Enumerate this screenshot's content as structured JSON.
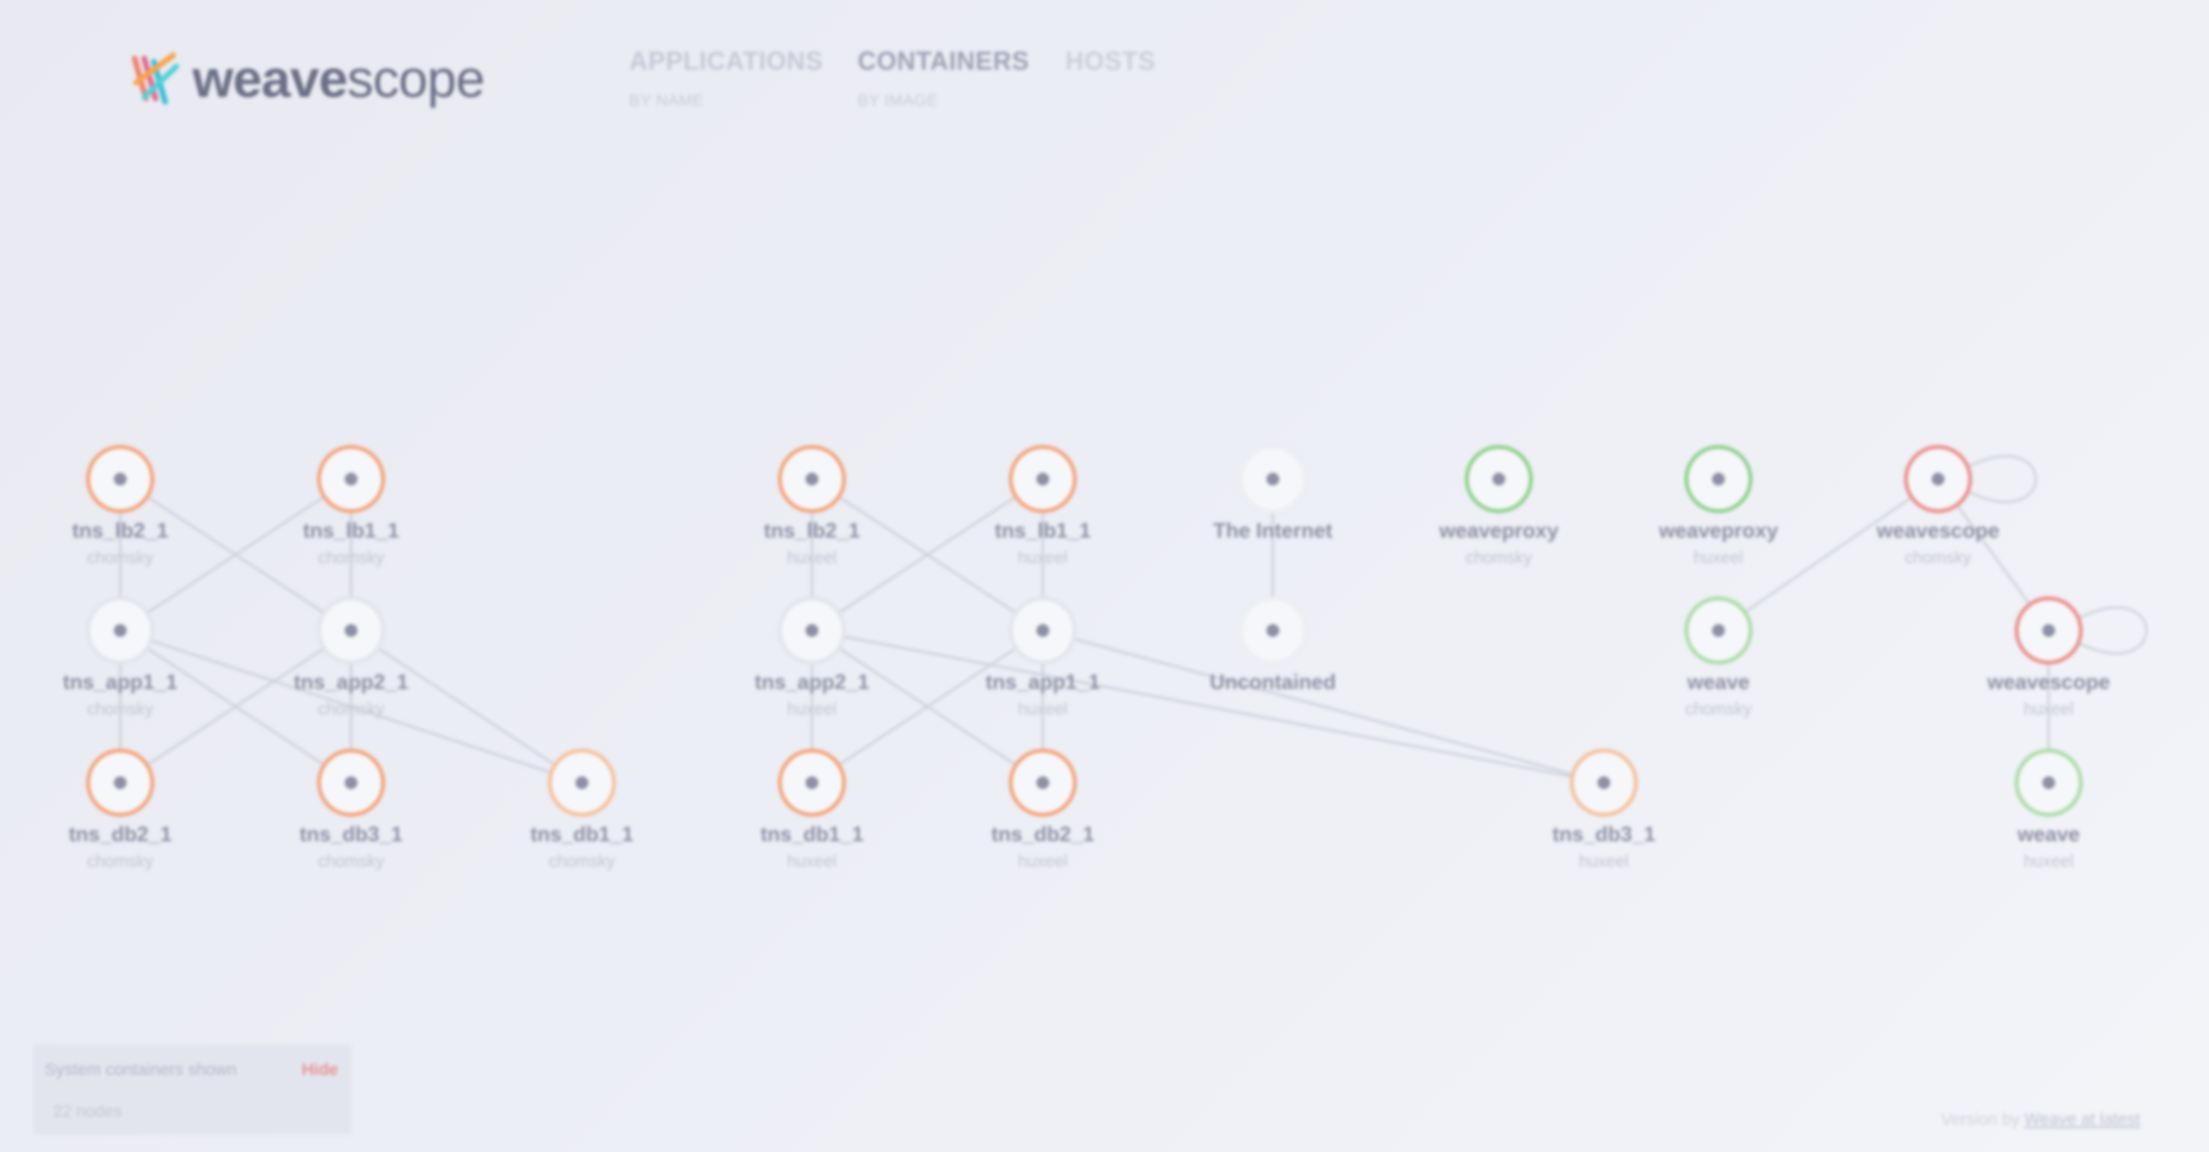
{
  "app": {
    "logo_weave": "weave",
    "logo_scope": "scope"
  },
  "topologies": [
    {
      "label": "APPLICATIONS",
      "sub": "BY NAME"
    },
    {
      "label": "CONTAINERS",
      "sub": "BY IMAGE"
    },
    {
      "label": "HOSTS",
      "sub": ""
    }
  ],
  "nodes": [
    {
      "id": "n1",
      "label": "tns_lb2_1",
      "sub": "chomsky",
      "color": "#f3a37a"
    },
    {
      "id": "n2",
      "label": "tns_lb1_1",
      "sub": "chomsky",
      "color": "#f3a37a"
    },
    {
      "id": "n3",
      "label": "tns_app1_1",
      "sub": "chomsky",
      "color": "#e2e4ec"
    },
    {
      "id": "n4",
      "label": "tns_app2_1",
      "sub": "chomsky",
      "color": "#e2e4ec"
    },
    {
      "id": "n5",
      "label": "tns_db2_1",
      "sub": "chomsky",
      "color": "#f3a37a"
    },
    {
      "id": "n6",
      "label": "tns_db3_1",
      "sub": "chomsky",
      "color": "#f3a37a"
    },
    {
      "id": "n7",
      "label": "tns_db1_1",
      "sub": "chomsky",
      "color": "#f5c09a"
    },
    {
      "id": "n8",
      "label": "tns_lb2_1",
      "sub": "huxeel",
      "color": "#f3a37a"
    },
    {
      "id": "n9",
      "label": "tns_lb1_1",
      "sub": "huxeel",
      "color": "#f3a37a"
    },
    {
      "id": "n10",
      "label": "tns_app2_1",
      "sub": "huxeel",
      "color": "#e2e4ec"
    },
    {
      "id": "n11",
      "label": "tns_app1_1",
      "sub": "huxeel",
      "color": "#e2e4ec"
    },
    {
      "id": "n12",
      "label": "tns_db1_1",
      "sub": "huxeel",
      "color": "#f3a37a"
    },
    {
      "id": "n13",
      "label": "tns_db2_1",
      "sub": "huxeel",
      "color": "#f3a37a"
    },
    {
      "id": "n14",
      "label": "The Internet",
      "sub": "",
      "color": "#eceef3"
    },
    {
      "id": "n15",
      "label": "Uncontained",
      "sub": "",
      "color": "#eceef3"
    },
    {
      "id": "n16",
      "label": "weaveproxy",
      "sub": "chomsky",
      "color": "#8fcf8c"
    },
    {
      "id": "n17",
      "label": "weaveproxy",
      "sub": "huxeel",
      "color": "#8fcf8c"
    },
    {
      "id": "n18",
      "label": "weave",
      "sub": "chomsky",
      "color": "#a9dca6"
    },
    {
      "id": "n19",
      "label": "weavescope",
      "sub": "chomsky",
      "color": "#ea8f8a"
    },
    {
      "id": "n20",
      "label": "weavescope",
      "sub": "huxeel",
      "color": "#ea8f8a"
    },
    {
      "id": "n21",
      "label": "tns_db3_1",
      "sub": "huxeel",
      "color": "#f5c09a"
    },
    {
      "id": "n22",
      "label": "weave",
      "sub": "huxeel",
      "color": "#a9dca6"
    }
  ],
  "status": {
    "text": "System containers shown",
    "hide_label": "Hide",
    "node_count": "22 nodes"
  },
  "footer": {
    "prefix": "Version by",
    "link_label": "Weave at latest"
  }
}
